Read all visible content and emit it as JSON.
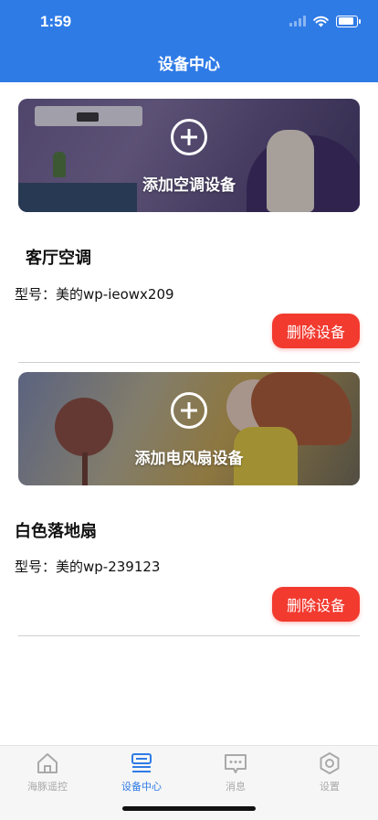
{
  "status": {
    "time": "1:59"
  },
  "header": {
    "title": "设备中心"
  },
  "devices": [
    {
      "banner_label": "添加空调设备",
      "name": "客厅空调",
      "model": "型号：美的wp-ieowx209",
      "delete_label": "删除设备"
    },
    {
      "banner_label": "添加电风扇设备",
      "name": "白色落地扇",
      "model": "型号：美的wp-239123",
      "delete_label": "删除设备"
    }
  ],
  "tabs": [
    {
      "label": "海豚遥控",
      "icon": "home-icon"
    },
    {
      "label": "设备中心",
      "icon": "device-icon",
      "active": true
    },
    {
      "label": "消息",
      "icon": "message-icon"
    },
    {
      "label": "设置",
      "icon": "settings-icon"
    }
  ],
  "colors": {
    "primary": "#2f7be6",
    "danger": "#f23a2f",
    "tab_inactive": "#a9a9a9"
  }
}
